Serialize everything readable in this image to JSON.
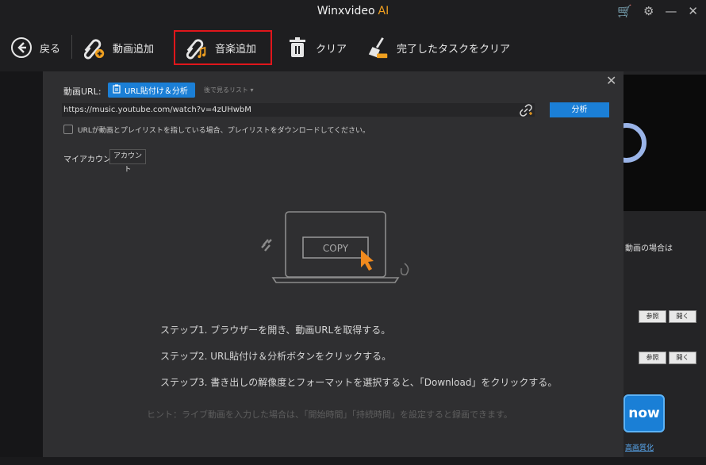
{
  "window": {
    "title": "Winxvideo",
    "title_suffix": "AI"
  },
  "titlebar_icons": [
    {
      "name": "cart-icon",
      "glyph": "🛒"
    },
    {
      "name": "settings-icon",
      "glyph": "⚙"
    },
    {
      "name": "minimize-icon",
      "glyph": "—"
    },
    {
      "name": "close-icon",
      "glyph": "✕"
    }
  ],
  "toolbar": {
    "back": "戻る",
    "add_video": "動画追加",
    "add_music": "音楽追加",
    "clear": "クリア",
    "clear_done": "完了したタスクをクリア"
  },
  "dialog": {
    "url_label": "動画URL:",
    "paste_button": "URL貼付け＆分析",
    "later_list": "後で見るリスト",
    "url_value": "https://music.youtube.com/watch?v=4zUHwbM",
    "analyze_button": "分析",
    "playlist_checkbox": "URLが動画とプレイリストを指している場合、プレイリストをダウンロードしてください。",
    "my_account_label": "マイアカウント",
    "account_button": "アカウント",
    "illustration_copy": "COPY",
    "steps": [
      "ステップ1. ブラウザーを開き、動画URLを取得する。",
      "ステップ2. URL貼付け＆分析ボタンをクリックする。",
      "ステップ3. 書き出しの解像度とフォーマットを選択すると、「Download」をクリックする。"
    ],
    "hint": "ヒント：ライブ動画を入力した場合は、「開始時間」「持続時間」を設定すると録画できます。"
  },
  "right_panel": {
    "note": "動画の場合は",
    "browse_1": "参照",
    "open_1": "開く",
    "browse_2": "参照",
    "open_2": "開く",
    "run_button": "now",
    "hq_link": "高画質化"
  },
  "colors": {
    "accent": "#1b7fd6",
    "highlight": "#e0161b",
    "brand": "#f0a020"
  }
}
